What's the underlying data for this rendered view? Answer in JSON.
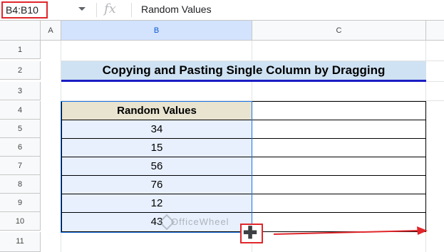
{
  "formula_bar": {
    "name_box": "B4:B10",
    "fx": "fx",
    "value": "Random Values"
  },
  "columns": [
    "A",
    "B",
    "C"
  ],
  "rows": [
    "1",
    "2",
    "3",
    "4",
    "5",
    "6",
    "7",
    "8",
    "9",
    "10",
    "11"
  ],
  "title": "Copying and Pasting Single Column by Dragging",
  "table": {
    "header": "Random Values",
    "values": [
      "34",
      "15",
      "56",
      "76",
      "12",
      "43"
    ]
  },
  "watermark": "OfficeWheel",
  "colors": {
    "name_box_border": "#e0262b",
    "title_bg": "#cfe2f3",
    "title_underline": "#1b1ec4",
    "header_bg": "#e8e4d0",
    "selected_bg": "#e8f0fe",
    "arrow": "#e0262b"
  },
  "icons": {
    "fill_handle": "plus-cursor-icon",
    "drag_arrow": "arrow-right-icon"
  }
}
